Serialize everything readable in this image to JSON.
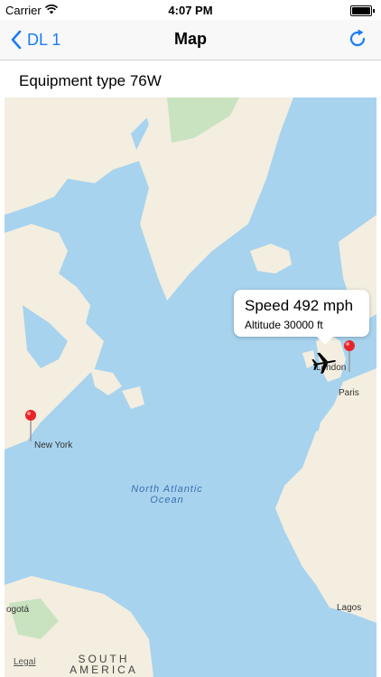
{
  "status_bar": {
    "carrier": "Carrier",
    "time": "4:07 PM"
  },
  "nav": {
    "back_label": "DL 1",
    "title": "Map",
    "icons": {
      "back": "chevron-left-icon",
      "refresh": "refresh-icon"
    },
    "accent_color": "#1a7cf5"
  },
  "equipment": {
    "label": "Equipment type 76W"
  },
  "map": {
    "ocean_label_line1": "North Atlantic",
    "ocean_label_line2": "Ocean",
    "continent_label_line1": "SOUTH",
    "continent_label_line2": "AMERICA",
    "legal": "Legal",
    "cities": {
      "new_york": "New York",
      "london": "London",
      "paris": "Paris",
      "lagos": "Lagos",
      "bogota": "ogotá"
    },
    "colors": {
      "water": "#a7d3ee",
      "land": "#f3eedf",
      "pin": "#e8242b"
    }
  },
  "flight_callout": {
    "speed": "Speed 492 mph",
    "altitude": "Altitude 30000 ft"
  }
}
